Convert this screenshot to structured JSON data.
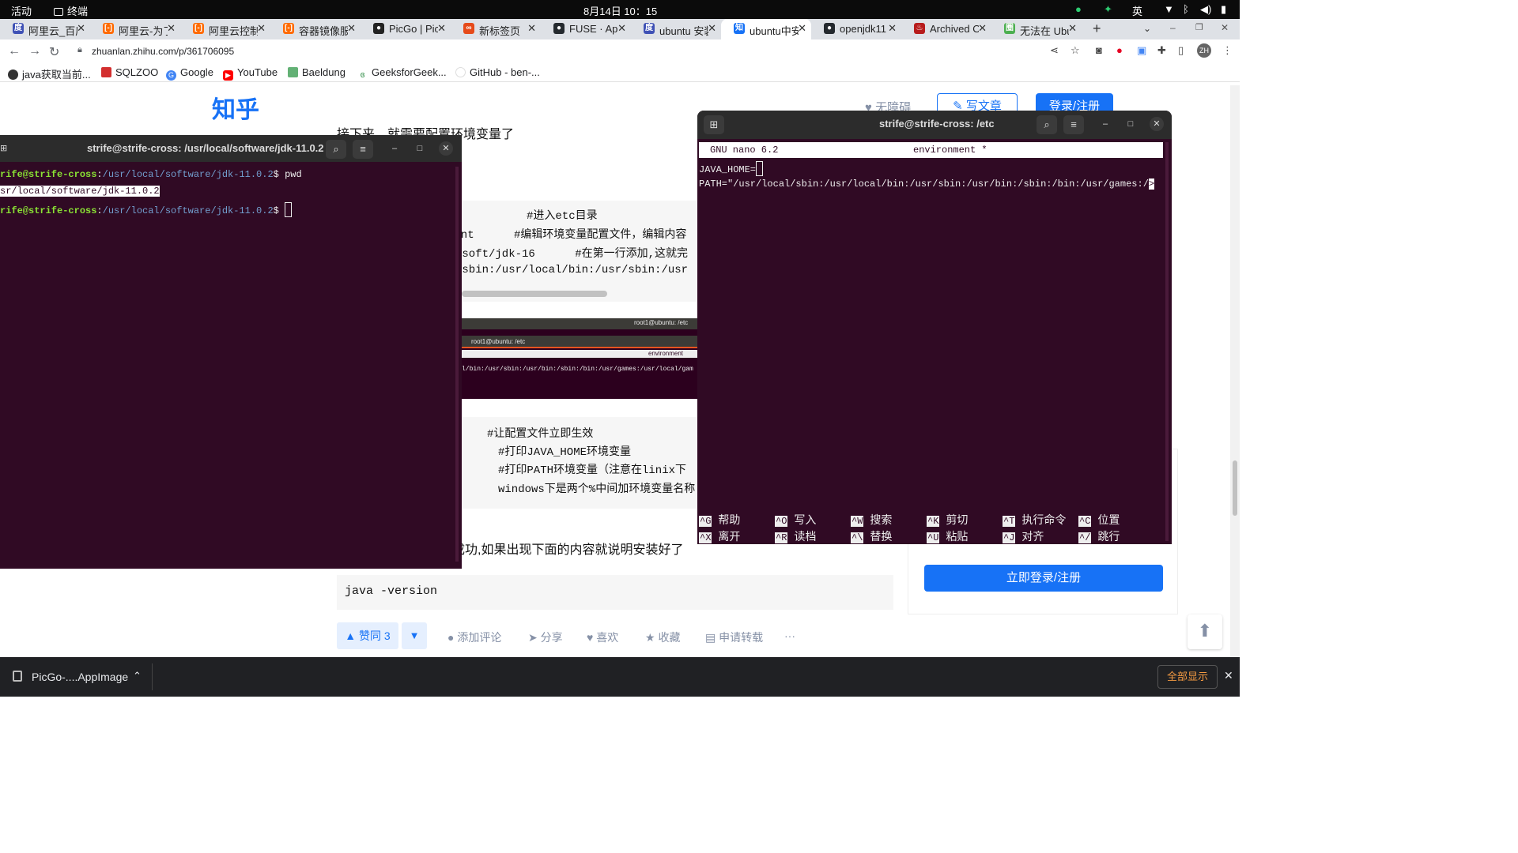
{
  "topbar": {
    "activities": "活动",
    "app": "终端",
    "clock": "8月14日 10：15",
    "ime": "英"
  },
  "tabs": [
    {
      "label": "阿里云_百度",
      "icon": "baidu-icon"
    },
    {
      "label": "阿里云-为了",
      "icon": "aliyun-icon"
    },
    {
      "label": "阿里云控制台",
      "icon": "aliyun-icon"
    },
    {
      "label": "容器镜像服务",
      "icon": "aliyun-icon"
    },
    {
      "label": "PicGo | PicGo",
      "icon": "picgo-icon"
    },
    {
      "label": "新标签页",
      "icon": "newtab-icon"
    },
    {
      "label": "FUSE · AppImage",
      "icon": "github-icon"
    },
    {
      "label": "ubuntu 安装",
      "icon": "baidu-icon"
    },
    {
      "label": "ubuntu中安装",
      "icon": "zhihu-icon"
    },
    {
      "label": "openjdk11",
      "icon": "github-icon"
    },
    {
      "label": "Archived OpenJDK",
      "icon": "java-icon"
    },
    {
      "label": "无法在 Ubuntu",
      "icon": "web-icon"
    }
  ],
  "address": {
    "url": "zhuanlan.zhihu.com/p/361706095"
  },
  "bookmarks": [
    "java获取当前...",
    "SQLZOO",
    "Google",
    "YouTube",
    "Baeldung",
    "GeeksforGeek...",
    "GitHub - ben-..."
  ],
  "zhihu": {
    "logo": "知乎",
    "no_barrier": "无障碍",
    "write": "写文章",
    "login_btn": "登录/注册",
    "intro": "接下来，就需要配置环境变量了",
    "code1": [
      "#进入etc目录",
      "ment      #编辑环境变量配置文件，编辑内容",
      "/soft/jdk-16      #在第一行添加,这就完",
      "/sbin:/usr/local/bin:/usr/sbin:/usr"
    ],
    "shot_title1": "root1@ubuntu: /etc",
    "shot_title2": "root1@ubuntu: /etc",
    "shot_file": "environment",
    "shot_path": "l/bin:/usr/sbin:/usr/bin:/sbin:/bin:/usr/games:/usr/local/gam",
    "code2": [
      "t    #让配置文件立即生效",
      "#打印JAVA_HOME环境变量",
      "#打印PATH环境变量（注意在linix下",
      "windows下是两个%中间加环境变量名称"
    ],
    "success_text": "装成功,如果出现下面的内容就说明安装好了",
    "java_cmd": "java -version",
    "login_register": "立即登录/注册",
    "upvote": "▲ 赞同 3",
    "downvote": "▼",
    "actions": [
      "添加评论",
      "分享",
      "喜欢",
      "收藏",
      "申请转载"
    ],
    "more": "···"
  },
  "terminal1": {
    "title": "strife@strife-cross: /usr/local/software/jdk-11.0.2",
    "user": "rife@strife-cross",
    "path": "/usr/local/software/jdk-11.0.2",
    "cmd": "pwd",
    "output": "sr/local/software/jdk-11.0.2"
  },
  "terminal2": {
    "title": "strife@strife-cross: /etc",
    "nano_version": "GNU nano 6.2",
    "nano_file": "environment *",
    "line1": "JAVA_HOME=",
    "line2": "PATH=\"/usr/local/sbin:/usr/local/bin:/usr/sbin:/usr/bin:/sbin:/bin:/usr/games:/",
    "overflow_marker": ">",
    "shortcuts": [
      {
        "key": "^G",
        "label": "帮助"
      },
      {
        "key": "^O",
        "label": "写入"
      },
      {
        "key": "^W",
        "label": "搜索"
      },
      {
        "key": "^K",
        "label": "剪切"
      },
      {
        "key": "^T",
        "label": "执行命令"
      },
      {
        "key": "^C",
        "label": "位置"
      },
      {
        "key": "^X",
        "label": "离开"
      },
      {
        "key": "^R",
        "label": "读档"
      },
      {
        "key": "^\\",
        "label": "替换"
      },
      {
        "key": "^U",
        "label": "粘贴"
      },
      {
        "key": "^J",
        "label": "对齐"
      },
      {
        "key": "^/",
        "label": "跳行"
      }
    ]
  },
  "download": {
    "file": "PicGo-....AppImage",
    "show_all": "全部显示"
  },
  "colors": {
    "terminal_bg": "#300a24",
    "zhihu_blue": "#1772f6",
    "prompt_green": "#8ae234"
  }
}
